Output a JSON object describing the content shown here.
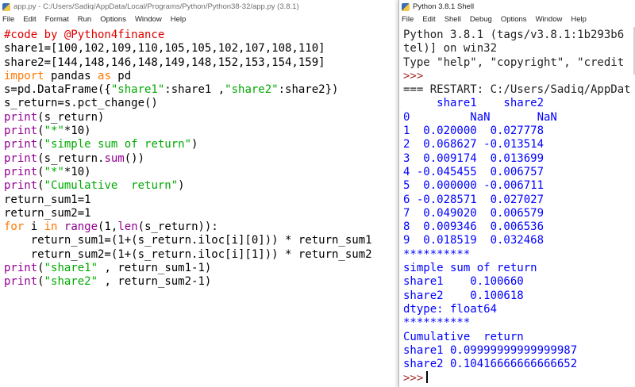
{
  "editor": {
    "title": "app.py - C:/Users/Sadiq/AppData/Local/Programs/Python/Python38-32/app.py (3.8.1)",
    "menu": [
      "File",
      "Edit",
      "Format",
      "Run",
      "Options",
      "Window",
      "Help"
    ],
    "lines": [
      [
        {
          "t": "#code by @Python4finance",
          "s": "comment"
        }
      ],
      [
        {
          "t": "share1=[100,102,109,110,105,105,102,107,108,110]",
          "s": "def"
        }
      ],
      [
        {
          "t": "share2=[144,148,146,148,149,148,152,153,154,159]",
          "s": "def"
        }
      ],
      [
        {
          "t": "import",
          "s": "kw"
        },
        {
          "t": " pandas ",
          "s": "def"
        },
        {
          "t": "as",
          "s": "kw"
        },
        {
          "t": " pd",
          "s": "def"
        }
      ],
      [
        {
          "t": "s=pd.DataFrame({",
          "s": "def"
        },
        {
          "t": "\"share1\"",
          "s": "str"
        },
        {
          "t": ":share1 ,",
          "s": "def"
        },
        {
          "t": "\"share2\"",
          "s": "str"
        },
        {
          "t": ":share2})",
          "s": "def"
        }
      ],
      [
        {
          "t": "s_return=s.pct_change()",
          "s": "def"
        }
      ],
      [
        {
          "t": "print",
          "s": "bi"
        },
        {
          "t": "(s_return)",
          "s": "def"
        }
      ],
      [
        {
          "t": "print",
          "s": "bi"
        },
        {
          "t": "(",
          "s": "def"
        },
        {
          "t": "\"*\"",
          "s": "str"
        },
        {
          "t": "*10)",
          "s": "def"
        }
      ],
      [
        {
          "t": "print",
          "s": "bi"
        },
        {
          "t": "(",
          "s": "def"
        },
        {
          "t": "\"simple sum of return\"",
          "s": "str"
        },
        {
          "t": ")",
          "s": "def"
        }
      ],
      [
        {
          "t": "print",
          "s": "bi"
        },
        {
          "t": "(s_return.",
          "s": "def"
        },
        {
          "t": "sum",
          "s": "bi"
        },
        {
          "t": "())",
          "s": "def"
        }
      ],
      [
        {
          "t": "print",
          "s": "bi"
        },
        {
          "t": "(",
          "s": "def"
        },
        {
          "t": "\"*\"",
          "s": "str"
        },
        {
          "t": "*10)",
          "s": "def"
        }
      ],
      [
        {
          "t": "print",
          "s": "bi"
        },
        {
          "t": "(",
          "s": "def"
        },
        {
          "t": "\"Cumulative  return\"",
          "s": "str"
        },
        {
          "t": ")",
          "s": "def"
        }
      ],
      [
        {
          "t": "return_sum1=1",
          "s": "def"
        }
      ],
      [
        {
          "t": "return_sum2=1",
          "s": "def"
        }
      ],
      [
        {
          "t": "for",
          "s": "kw"
        },
        {
          "t": " i ",
          "s": "def"
        },
        {
          "t": "in",
          "s": "kw"
        },
        {
          "t": " ",
          "s": "def"
        },
        {
          "t": "range",
          "s": "bi"
        },
        {
          "t": "(1,",
          "s": "def"
        },
        {
          "t": "len",
          "s": "bi"
        },
        {
          "t": "(s_return)):",
          "s": "def"
        }
      ],
      [
        {
          "t": "    return_sum1=(1+(s_return.iloc[i][0])) * return_sum1",
          "s": "def"
        }
      ],
      [
        {
          "t": "    return_sum2=(1+(s_return.iloc[i][1])) * return_sum2",
          "s": "def"
        }
      ],
      [
        {
          "t": "print",
          "s": "bi"
        },
        {
          "t": "(",
          "s": "def"
        },
        {
          "t": "\"share1\"",
          "s": "str"
        },
        {
          "t": " , return_sum1-1)",
          "s": "def"
        }
      ],
      [
        {
          "t": "print",
          "s": "bi"
        },
        {
          "t": "(",
          "s": "def"
        },
        {
          "t": "\"share2\"",
          "s": "str"
        },
        {
          "t": " , return_sum2-1)",
          "s": "def"
        }
      ]
    ]
  },
  "shell": {
    "title": "Python 3.8.1 Shell",
    "menu": [
      "File",
      "Edit",
      "Shell",
      "Debug",
      "Options",
      "Window",
      "Help"
    ],
    "lines": [
      [
        {
          "t": "Python 3.8.1 (tags/v3.8.1:1b293b6",
          "s": "info"
        }
      ],
      [
        {
          "t": "tel)] on win32",
          "s": "info"
        }
      ],
      [
        {
          "t": "Type \"help\", \"copyright\", \"credit",
          "s": "info"
        }
      ],
      [
        {
          "t": ">>>",
          "s": "prompt"
        }
      ],
      [
        {
          "t": "=== RESTART: C:/Users/Sadiq/AppDat",
          "s": "restart"
        }
      ],
      [
        {
          "t": "     share1    share2",
          "s": "stdout"
        }
      ],
      [
        {
          "t": "0         NaN       NaN",
          "s": "stdout"
        }
      ],
      [
        {
          "t": "1  0.020000  0.027778",
          "s": "stdout"
        }
      ],
      [
        {
          "t": "2  0.068627 -0.013514",
          "s": "stdout"
        }
      ],
      [
        {
          "t": "3  0.009174  0.013699",
          "s": "stdout"
        }
      ],
      [
        {
          "t": "4 -0.045455  0.006757",
          "s": "stdout"
        }
      ],
      [
        {
          "t": "5  0.000000 -0.006711",
          "s": "stdout"
        }
      ],
      [
        {
          "t": "6 -0.028571  0.027027",
          "s": "stdout"
        }
      ],
      [
        {
          "t": "7  0.049020  0.006579",
          "s": "stdout"
        }
      ],
      [
        {
          "t": "8  0.009346  0.006536",
          "s": "stdout"
        }
      ],
      [
        {
          "t": "9  0.018519  0.032468",
          "s": "stdout"
        }
      ],
      [
        {
          "t": "**********",
          "s": "stdout"
        }
      ],
      [
        {
          "t": "simple sum of return",
          "s": "stdout"
        }
      ],
      [
        {
          "t": "share1    0.100660",
          "s": "stdout"
        }
      ],
      [
        {
          "t": "share2    0.100618",
          "s": "stdout"
        }
      ],
      [
        {
          "t": "dtype: float64",
          "s": "stdout"
        }
      ],
      [
        {
          "t": "**********",
          "s": "stdout"
        }
      ],
      [
        {
          "t": "Cumulative  return",
          "s": "stdout"
        }
      ],
      [
        {
          "t": "share1 0.09999999999999987",
          "s": "stdout"
        }
      ],
      [
        {
          "t": "share2 0.10416666666666652",
          "s": "stdout"
        }
      ]
    ],
    "prompt": ">>>"
  },
  "colors": {
    "comment": "#dd0000",
    "keyword": "#ff7700",
    "builtin": "#900090",
    "string": "#00aa00",
    "stdout": "#0000ff",
    "prompt": "#a52a2a"
  }
}
